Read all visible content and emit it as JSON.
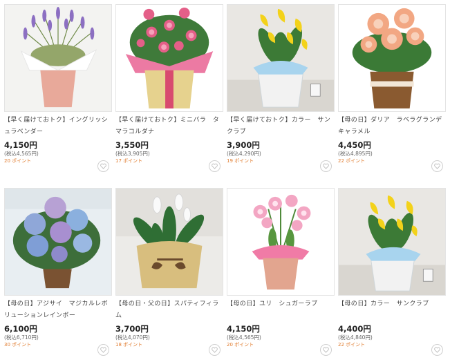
{
  "products": [
    {
      "title": "【早く届けておトク】イングリッシュラベンダー",
      "price": "4,150円",
      "tax_in": "(税込4,565円)",
      "points": "20 ポイント",
      "image": "lavender-pot",
      "fav_icon": "heart-icon"
    },
    {
      "title": "【早く届けておトク】ミニバラ　タマラコルダナ",
      "price": "3,550円",
      "tax_in": "(税込3,905円)",
      "points": "17 ポイント",
      "image": "mini-rose-pot",
      "fav_icon": "heart-icon"
    },
    {
      "title": "【早く届けておトク】カラー　サンクラブ",
      "price": "3,900円",
      "tax_in": "(税込4,290円)",
      "points": "19 ポイント",
      "image": "calla-pot",
      "fav_icon": "heart-icon"
    },
    {
      "title": "【母の日】ダリア　ラベラグランデキャラメル",
      "price": "4,450円",
      "tax_in": "(税込4,895円)",
      "points": "22 ポイント",
      "image": "dahlia-pot",
      "fav_icon": "heart-icon"
    },
    {
      "title": "【母の日】アジサイ　マジカルレボリューションレインボー",
      "price": "6,100円",
      "tax_in": "(税込6,710円)",
      "points": "30 ポイント",
      "image": "hydrangea-pot",
      "fav_icon": "heart-icon"
    },
    {
      "title": "【母の日・父の日】スパティフィラム",
      "price": "3,700円",
      "tax_in": "(税込4,070円)",
      "points": "18 ポイント",
      "image": "spathiphyllum-pot",
      "fav_icon": "heart-icon"
    },
    {
      "title": "【母の日】ユリ　シュガーラブ",
      "price": "4,150円",
      "tax_in": "(税込4,565円)",
      "points": "20 ポイント",
      "image": "lily-pot",
      "fav_icon": "heart-icon"
    },
    {
      "title": "【母の日】カラー　サンクラブ",
      "price": "4,400円",
      "tax_in": "(税込4,840円)",
      "points": "22 ポイント",
      "image": "calla-pot-2",
      "fav_icon": "heart-icon"
    }
  ],
  "colors": {
    "points": "#e07a2c",
    "border": "#e4e4e4",
    "price": "#222222"
  }
}
